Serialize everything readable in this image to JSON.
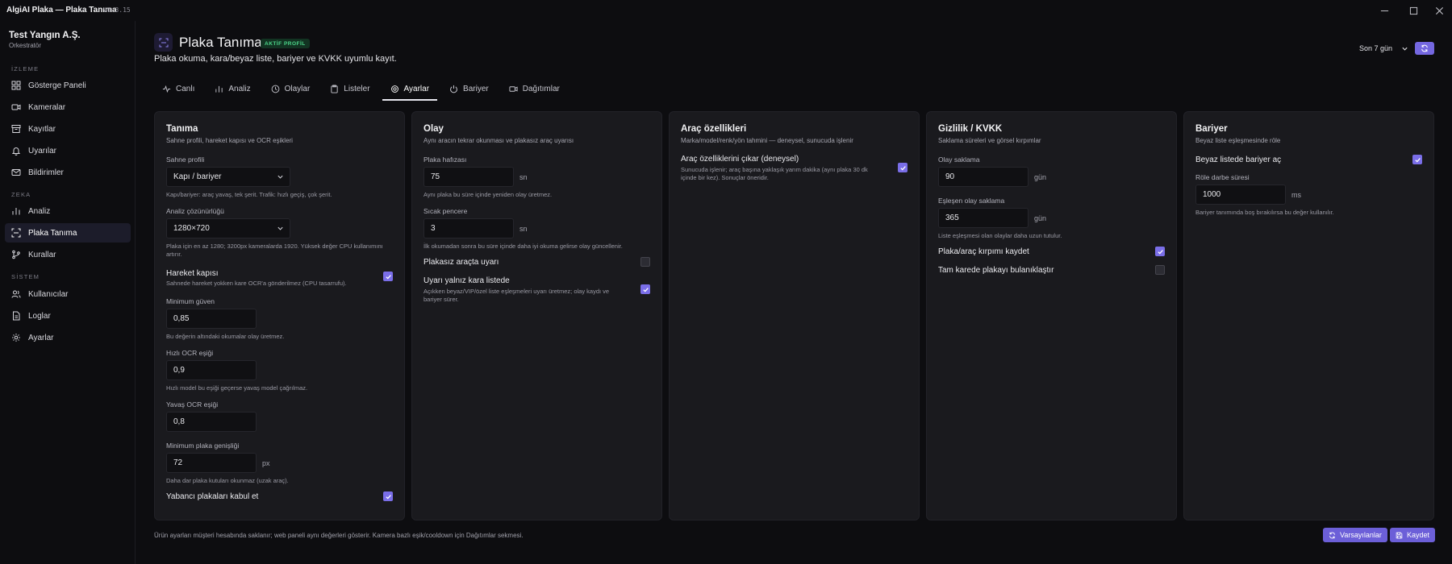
{
  "window": {
    "title": "AlgiAI Plaka — Plaka Tanıma",
    "version": "v0.3.15"
  },
  "sidebar": {
    "org_name": "Test Yangın A.Ş.",
    "org_role": "Orkestratör",
    "sections": {
      "izleme": "İZLEME",
      "zeka": "ZEKA",
      "sistem": "SİSTEM"
    },
    "items": {
      "dashboard": "Gösterge Paneli",
      "cameras": "Kameralar",
      "records": "Kayıtlar",
      "alerts": "Uyarılar",
      "notifications": "Bildirimler",
      "analysis": "Analiz",
      "plate": "Plaka Tanıma",
      "rules": "Kurallar",
      "users": "Kullanıcılar",
      "logs": "Loglar",
      "settings": "Ayarlar"
    },
    "active": "plate"
  },
  "header": {
    "title": "Plaka Tanıma",
    "badge": "AKTİF PROFİL",
    "subtitle": "Plaka okuma, kara/beyaz liste, bariyer ve KVKK uyumlu kayıt.",
    "period": "Son 7 gün"
  },
  "tabs": {
    "live": "Canlı",
    "analysis": "Analiz",
    "events": "Olaylar",
    "lists": "Listeler",
    "settings": "Ayarlar",
    "barrier": "Bariyer",
    "deployments": "Dağıtımlar"
  },
  "cards": {
    "tanima": {
      "title": "Tanıma",
      "subtitle": "Sahne profili, hareket kapısı ve OCR eşikleri",
      "scene_label": "Sahne profili",
      "scene_value": "Kapı / bariyer",
      "scene_hint": "Kapı/bariyer: araç yavaş, tek şerit. Trafik: hızlı geçiş, çok şerit.",
      "res_label": "Analiz çözünürlüğü",
      "res_value": "1280×720",
      "res_hint": "Plaka için en az 1280; 3200px kameralarda 1920. Yüksek değer CPU kullanımını artırır.",
      "motion_label": "Hareket kapısı",
      "motion_hint": "Sahnede hareket yokken kare OCR'a gönderilmez (CPU tasarrufu).",
      "motion_checked": true,
      "min_conf_label": "Minimum güven",
      "min_conf_value": "0,85",
      "min_conf_hint": "Bu değerin altındaki okumalar olay üretmez.",
      "fast_label": "Hızlı OCR eşiği",
      "fast_value": "0,9",
      "fast_hint": "Hızlı model bu eşiği geçerse yavaş model çağrılmaz.",
      "slow_label": "Yavaş OCR eşiği",
      "slow_value": "0,8",
      "min_width_label": "Minimum plaka genişliği",
      "min_width_value": "72",
      "min_width_unit": "px",
      "min_width_hint": "Daha dar plaka kutuları okunmaz (uzak araç).",
      "foreign_label": "Yabancı plakaları kabul et",
      "foreign_checked": true
    },
    "olay": {
      "title": "Olay",
      "subtitle": "Aynı aracın tekrar okunması ve plakasız araç uyarısı",
      "memory_label": "Plaka hafızası",
      "memory_value": "75",
      "memory_unit": "sn",
      "memory_hint": "Aynı plaka bu süre içinde yeniden olay üretmez.",
      "hot_label": "Sıcak pencere",
      "hot_value": "3",
      "hot_unit": "sn",
      "hot_hint": "İlk okumadan sonra bu süre içinde daha iyi okuma gelirse olay güncellenir.",
      "noplate_label": "Plakasız araçta uyarı",
      "noplate_checked": false,
      "blacklist_label": "Uyarı yalnız kara listede",
      "blacklist_hint": "Açıkken beyaz/VIP/özel liste eşleşmeleri uyarı üretmez; olay kaydı ve bariyer sürer.",
      "blacklist_checked": true
    },
    "arac": {
      "title": "Araç özellikleri",
      "subtitle": "Marka/model/renk/yön tahmini — deneysel, sunucuda işlenir",
      "extract_label": "Araç özelliklerini çıkar (deneysel)",
      "extract_hint": "Sunucuda işlenir; araç başına yaklaşık yarım dakika (aynı plaka 30 dk içinde bir kez). Sonuçlar öneridir.",
      "extract_checked": true
    },
    "gizlilik": {
      "title": "Gizlilik / KVKK",
      "subtitle": "Saklama süreleri ve görsel kırpımlar",
      "event_ret_label": "Olay saklama",
      "event_ret_value": "90",
      "event_ret_unit": "gün",
      "match_ret_label": "Eşleşen olay saklama",
      "match_ret_value": "365",
      "match_ret_unit": "gün",
      "match_ret_hint": "Liste eşleşmesi olan olaylar daha uzun tutulur.",
      "crop_label": "Plaka/araç kırpımı kaydet",
      "crop_checked": true,
      "blur_label": "Tam karede plakayı bulanıklaştır",
      "blur_checked": false
    },
    "bariyer": {
      "title": "Bariyer",
      "subtitle": "Beyaz liste eşleşmesinde röle",
      "open_label": "Beyaz listede bariyer aç",
      "open_checked": true,
      "pulse_label": "Röle darbe süresi",
      "pulse_value": "1000",
      "pulse_unit": "ms",
      "pulse_hint": "Bariyer tanımında boş bırakılırsa bu değer kullanılır."
    }
  },
  "footer": {
    "note": "Ürün ayarları müşteri hesabında saklanır; web paneli aynı değerleri gösterir. Kamera bazlı eşik/cooldown için Dağıtımlar sekmesi.",
    "defaults_label": "Varsayılanlar",
    "save_label": "Kaydet"
  },
  "colors": {
    "accent": "#7a6ee8",
    "badge_text": "#4cd68a",
    "card_bg": "#1a1a1e",
    "page_bg": "#0d0d10"
  },
  "icons": {
    "dashboard": "grid-icon",
    "cameras": "video-camera-icon",
    "records": "archive-icon",
    "alerts": "bell-icon",
    "notifications": "mail-icon",
    "analysis": "bar-chart-icon",
    "plate": "scan-icon",
    "rules": "git-branch-icon",
    "users": "users-icon",
    "logs": "file-text-icon",
    "settings": "gear-icon"
  }
}
